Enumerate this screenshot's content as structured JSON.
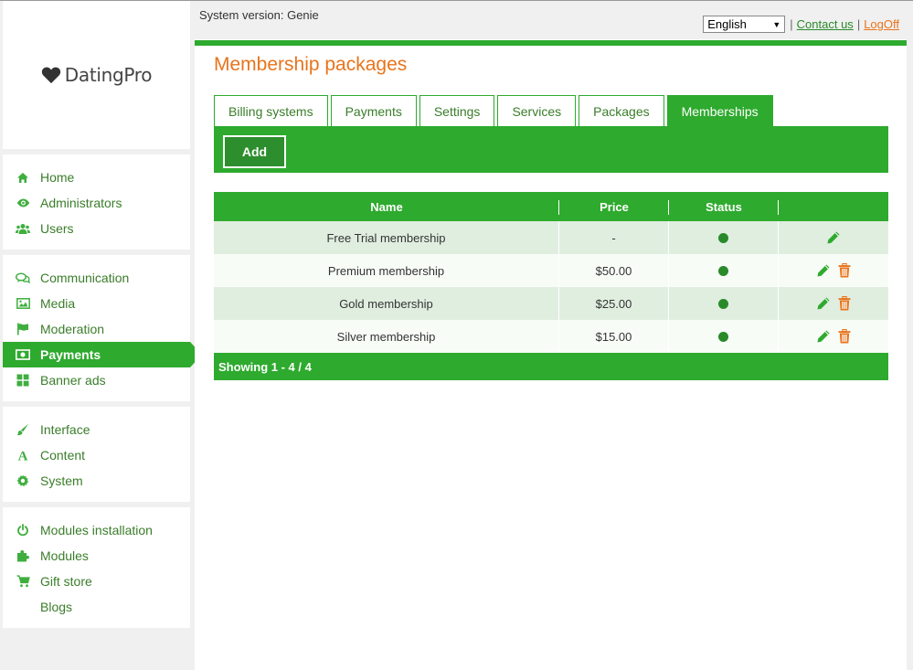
{
  "header": {
    "system_version": "System version: Genie",
    "language": "English",
    "contact_label": "Contact us",
    "logoff_label": "LogOff",
    "separator": "|"
  },
  "logo": {
    "text": "DatingPro"
  },
  "sidebar": {
    "groups": [
      [
        {
          "label": "Home",
          "icon": "home-icon"
        },
        {
          "label": "Administrators",
          "icon": "eye-icon"
        },
        {
          "label": "Users",
          "icon": "users-icon"
        }
      ],
      [
        {
          "label": "Communication",
          "icon": "chat-icon"
        },
        {
          "label": "Media",
          "icon": "image-icon"
        },
        {
          "label": "Moderation",
          "icon": "flag-icon"
        },
        {
          "label": "Payments",
          "icon": "money-icon",
          "active": true
        },
        {
          "label": "Banner ads",
          "icon": "grid-icon"
        }
      ],
      [
        {
          "label": "Interface",
          "icon": "brush-icon"
        },
        {
          "label": "Content",
          "icon": "font-icon"
        },
        {
          "label": "System",
          "icon": "gear-icon"
        }
      ],
      [
        {
          "label": "Modules installation",
          "icon": "power-icon"
        },
        {
          "label": "Modules",
          "icon": "puzzle-icon"
        },
        {
          "label": "Gift store",
          "icon": "cart-icon"
        },
        {
          "label": "Blogs",
          "icon": ""
        }
      ]
    ]
  },
  "page": {
    "title": "Membership packages"
  },
  "tabs": [
    {
      "label": "Billing systems"
    },
    {
      "label": "Payments"
    },
    {
      "label": "Settings"
    },
    {
      "label": "Services"
    },
    {
      "label": "Packages"
    },
    {
      "label": "Memberships",
      "active": true
    }
  ],
  "toolbar": {
    "add_label": "Add"
  },
  "table": {
    "columns": [
      "Name",
      "Price",
      "Status",
      ""
    ],
    "rows": [
      {
        "name": "Free Trial membership",
        "price": "-",
        "status": "active",
        "deletable": false
      },
      {
        "name": "Premium membership",
        "price": "$50.00",
        "status": "active",
        "deletable": true
      },
      {
        "name": "Gold membership",
        "price": "$25.00",
        "status": "active",
        "deletable": true
      },
      {
        "name": "Silver membership",
        "price": "$15.00",
        "status": "active",
        "deletable": true
      }
    ],
    "footer": "Showing 1 - 4 / 4"
  },
  "colors": {
    "accent": "#2eaa2e",
    "title": "#e8741b",
    "delete": "#e8741b"
  }
}
